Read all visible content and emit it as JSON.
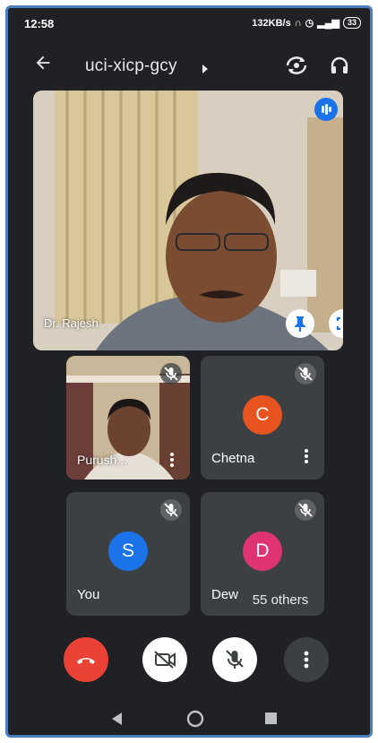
{
  "status_bar": {
    "time": "12:58",
    "net_speed": "132KB/s",
    "battery": "33"
  },
  "header": {
    "meeting_code": "uci-xicp-gcy"
  },
  "main_tile": {
    "name": "Dr. Rajesh"
  },
  "tiles": [
    {
      "name": "Purush...",
      "type": "video"
    },
    {
      "name": "Chetna",
      "initial": "C",
      "avatar_color": "#e8541f"
    },
    {
      "name": "You",
      "initial": "S",
      "avatar_color": "#1a73e8"
    },
    {
      "name": "Dew",
      "initial": "D",
      "avatar_color": "#e03374"
    }
  ],
  "others_label": "55 others",
  "colors": {
    "background": "#202124",
    "tile": "#3c4043",
    "end_call": "#ea4335",
    "accent": "#1a73e8"
  },
  "icons": [
    "back-arrow-icon",
    "caret-right-icon",
    "flip-camera-icon",
    "headphones-icon",
    "pin-icon",
    "fullscreen-icon",
    "mic-off-icon",
    "more-vert-icon",
    "end-call-icon",
    "camera-off-icon"
  ]
}
